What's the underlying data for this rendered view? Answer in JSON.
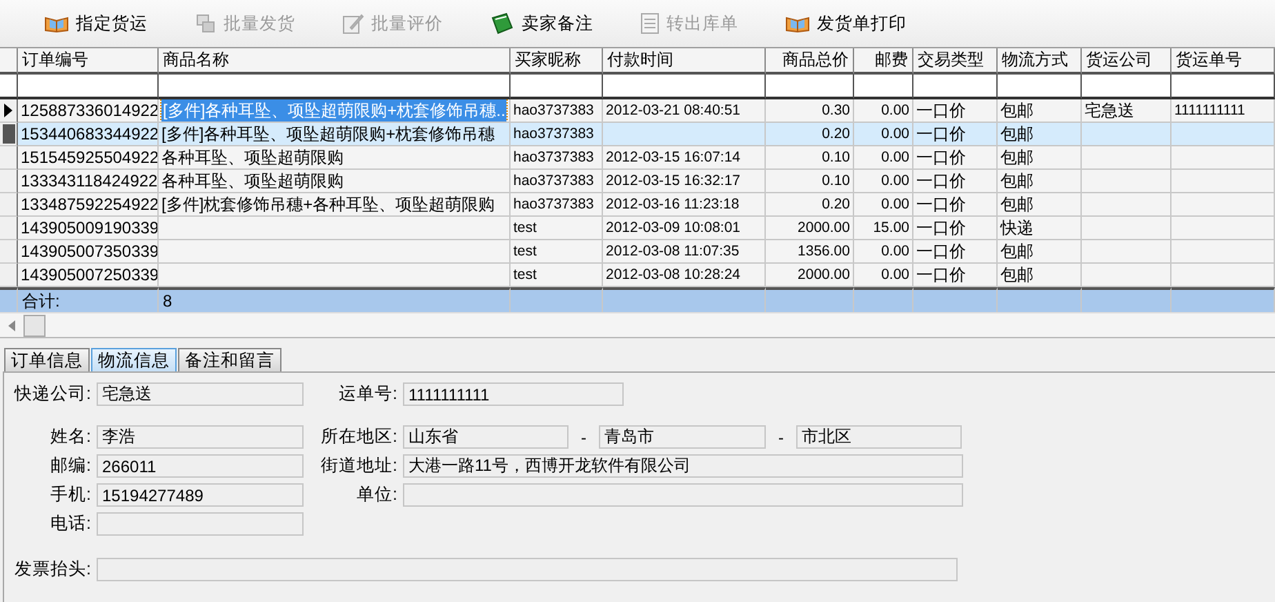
{
  "toolbar": [
    {
      "label": "指定货运",
      "disabled": false
    },
    {
      "label": "批量发货",
      "disabled": true
    },
    {
      "label": "批量评价",
      "disabled": true
    },
    {
      "label": "卖家备注",
      "disabled": false
    },
    {
      "label": "转出库单",
      "disabled": true
    },
    {
      "label": "发货单打印",
      "disabled": false
    }
  ],
  "table": {
    "columns": [
      "订单编号",
      "商品名称",
      "买家昵称",
      "付款时间",
      "商品总价",
      "邮费",
      "交易类型",
      "物流方式",
      "货运公司",
      "货运单号"
    ],
    "rows": [
      {
        "current": true,
        "selected": false,
        "cells": [
          "125887336014922",
          "[多件]各种耳坠、项坠超萌限购+枕套修饰吊穗..",
          "hao3737383",
          "2012-03-21 08:40:51",
          "0.30",
          "0.00",
          "一口价",
          "包邮",
          "宅急送",
          "1111111111"
        ]
      },
      {
        "current": false,
        "selected": true,
        "cells": [
          "153440683344922",
          "[多件]各种耳坠、项坠超萌限购+枕套修饰吊穗",
          "hao3737383",
          "",
          "0.20",
          "0.00",
          "一口价",
          "包邮",
          "",
          ""
        ]
      },
      {
        "current": false,
        "selected": false,
        "cells": [
          "151545925504922",
          "各种耳坠、项坠超萌限购",
          "hao3737383",
          "2012-03-15 16:07:14",
          "0.10",
          "0.00",
          "一口价",
          "包邮",
          "",
          ""
        ]
      },
      {
        "current": false,
        "selected": false,
        "cells": [
          "133343118424922",
          "各种耳坠、项坠超萌限购",
          "hao3737383",
          "2012-03-15 16:32:17",
          "0.10",
          "0.00",
          "一口价",
          "包邮",
          "",
          ""
        ]
      },
      {
        "current": false,
        "selected": false,
        "cells": [
          "133487592254922",
          "[多件]枕套修饰吊穗+各种耳坠、项坠超萌限购",
          "hao3737383",
          "2012-03-16 11:23:18",
          "0.20",
          "0.00",
          "一口价",
          "包邮",
          "",
          ""
        ]
      },
      {
        "current": false,
        "selected": false,
        "cells": [
          "143905009190339",
          "",
          "test",
          "2012-03-09 10:08:01",
          "2000.00",
          "15.00",
          "一口价",
          "快递",
          "",
          ""
        ]
      },
      {
        "current": false,
        "selected": false,
        "cells": [
          "143905007350339",
          "",
          "test",
          "2012-03-08 11:07:35",
          "1356.00",
          "0.00",
          "一口价",
          "包邮",
          "",
          ""
        ]
      },
      {
        "current": false,
        "selected": false,
        "cells": [
          "143905007250339",
          "",
          "test",
          "2012-03-08 10:28:24",
          "2000.00",
          "0.00",
          "一口价",
          "包邮",
          "",
          ""
        ]
      }
    ],
    "total": {
      "label": "合计:",
      "count": "8"
    }
  },
  "tabs": [
    {
      "label": "订单信息",
      "selected": false
    },
    {
      "label": "物流信息",
      "selected": true
    },
    {
      "label": "备注和留言",
      "selected": false
    }
  ],
  "logistics": {
    "courier": {
      "label": "快递公司:",
      "value": "宅急送"
    },
    "tracking_no": {
      "label": "运单号:",
      "value": "1111111111"
    },
    "name": {
      "label": "姓名:",
      "value": "李浩"
    },
    "region": {
      "label": "所在地区:",
      "province": "山东省",
      "city": "青岛市",
      "district": "市北区",
      "separators": [
        "-",
        "-"
      ]
    },
    "postcode": {
      "label": "邮编:",
      "value": "266011"
    },
    "street": {
      "label": "街道地址:",
      "value": "大港一路11号，西博开龙软件有限公司"
    },
    "mobile": {
      "label": "手机:",
      "value": "15194277489"
    },
    "company": {
      "label": "单位:"
    },
    "phone": {
      "label": "电话:"
    },
    "invoice_title": {
      "label": "发票抬头:"
    }
  }
}
